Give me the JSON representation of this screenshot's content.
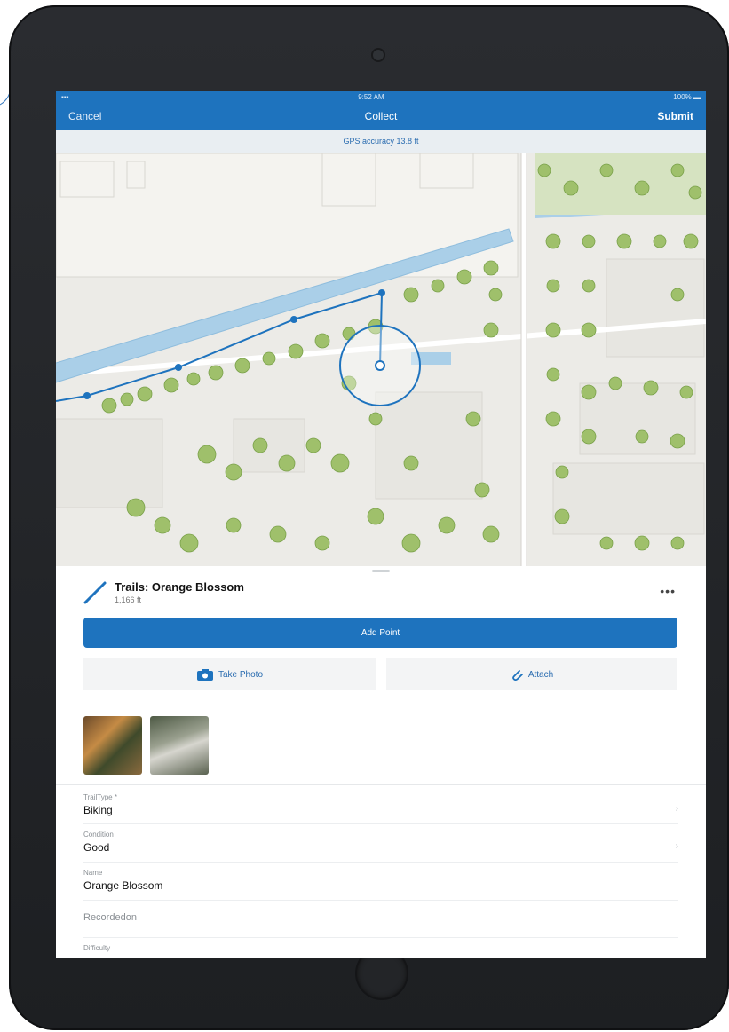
{
  "status": {
    "time": "9:52 AM",
    "battery": "100%"
  },
  "nav": {
    "cancel": "Cancel",
    "title": "Collect",
    "submit": "Submit"
  },
  "gps": {
    "text": "GPS accuracy 13.8 ft"
  },
  "sheet": {
    "title": "Trails: Orange Blossom",
    "length": "1,166 ft",
    "more": "•••",
    "add_point": "Add Point",
    "take_photo": "Take Photo",
    "attach": "Attach"
  },
  "fields": [
    {
      "label": "TrailType *",
      "value": "Biking"
    },
    {
      "label": "Condition",
      "value": "Good"
    },
    {
      "label": "Name",
      "value": "Orange Blossom"
    },
    {
      "placeholder": "Recordedon"
    },
    {
      "label": "Difficulty"
    }
  ],
  "colors": {
    "accent": "#1e73be",
    "map_bg": "#ecebe7",
    "water": "#aacfe8",
    "tree": "#9fc06b"
  }
}
